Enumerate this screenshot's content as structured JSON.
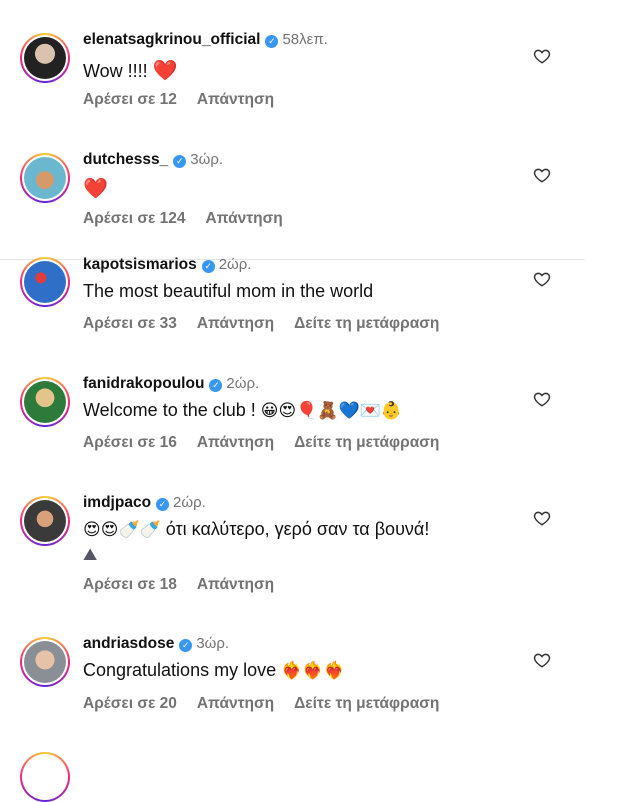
{
  "comments": [
    {
      "username": "elenatsagkrinou_official",
      "time": "58λεπ.",
      "text": "Wow !!!!",
      "emojis": "❤️",
      "likes": "Αρέσει σε 12",
      "reply": "Απάντηση",
      "translate": ""
    },
    {
      "username": "dutchesss_",
      "time": "3ώρ.",
      "text": "",
      "emojis": "❤️",
      "likes": "Αρέσει σε 124",
      "reply": "Απάντηση",
      "translate": ""
    },
    {
      "username": "kapotsismarios",
      "time": "2ώρ.",
      "text": "The most beautiful mom in the world",
      "emojis": "",
      "likes": "Αρέσει σε 33",
      "reply": "Απάντηση",
      "translate": "Δείτε τη μετάφραση"
    },
    {
      "username": "fanidrakopoulou",
      "time": "2ώρ.",
      "text": "Welcome to the club !",
      "emojis": "😀😍🎈🧸💙💌👶",
      "likes": "Αρέσει σε 16",
      "reply": "Απάντηση",
      "translate": "Δείτε τη μετάφραση"
    },
    {
      "username": "imdjpaco",
      "time": "2ώρ.",
      "text": "ότι καλύτερο, γερό σαν τα βουνά!",
      "emojis": "😍😍🍼🍼",
      "emojis_line2": "⛰",
      "likes": "Αρέσει σε 18",
      "reply": "Απάντηση",
      "translate": ""
    },
    {
      "username": "andriasdose",
      "time": "3ώρ.",
      "text": "Congratulations my love",
      "emojis": "❤️‍🔥❤️‍🔥❤️‍🔥",
      "likes": "Αρέσει σε 20",
      "reply": "Απάντηση",
      "translate": "Δείτε τη μετάφραση"
    }
  ],
  "colors": {
    "verified": "#3897f0",
    "muted": "#737373",
    "heart_red": "#ed1c40"
  },
  "icons": {
    "verified": "verified-badge-icon",
    "like": "heart-outline-icon"
  }
}
